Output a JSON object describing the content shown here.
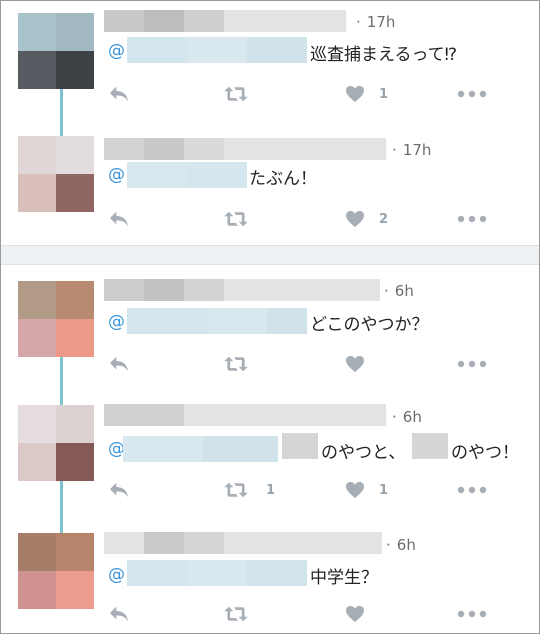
{
  "tweets": [
    {
      "time": "17h",
      "text": "巡査捕まえるって⁉",
      "reply_count": "",
      "retweet_count": "",
      "like_count": "1"
    },
    {
      "time": "17h",
      "text": "たぶん！",
      "reply_count": "",
      "retweet_count": "",
      "like_count": "2"
    },
    {
      "time": "6h",
      "text": "どこのやつか？",
      "reply_count": "",
      "retweet_count": "",
      "like_count": ""
    },
    {
      "time": "6h",
      "text_part1": "のやつと、",
      "text_part2": "のやつ！",
      "reply_count": "",
      "retweet_count": "1",
      "like_count": "1"
    },
    {
      "time": "6h",
      "text": "中学生？",
      "reply_count": "",
      "retweet_count": "",
      "like_count": ""
    }
  ],
  "mention_prefix": "@",
  "time_dot": "·",
  "icons": {
    "reply": "reply-icon",
    "retweet": "retweet-icon",
    "like": "heart-icon",
    "more": "more-dots-icon"
  },
  "colors": {
    "mention": "#3a94d8",
    "thread_line": "#7fc1cc",
    "icon": "#a7aeb6"
  }
}
